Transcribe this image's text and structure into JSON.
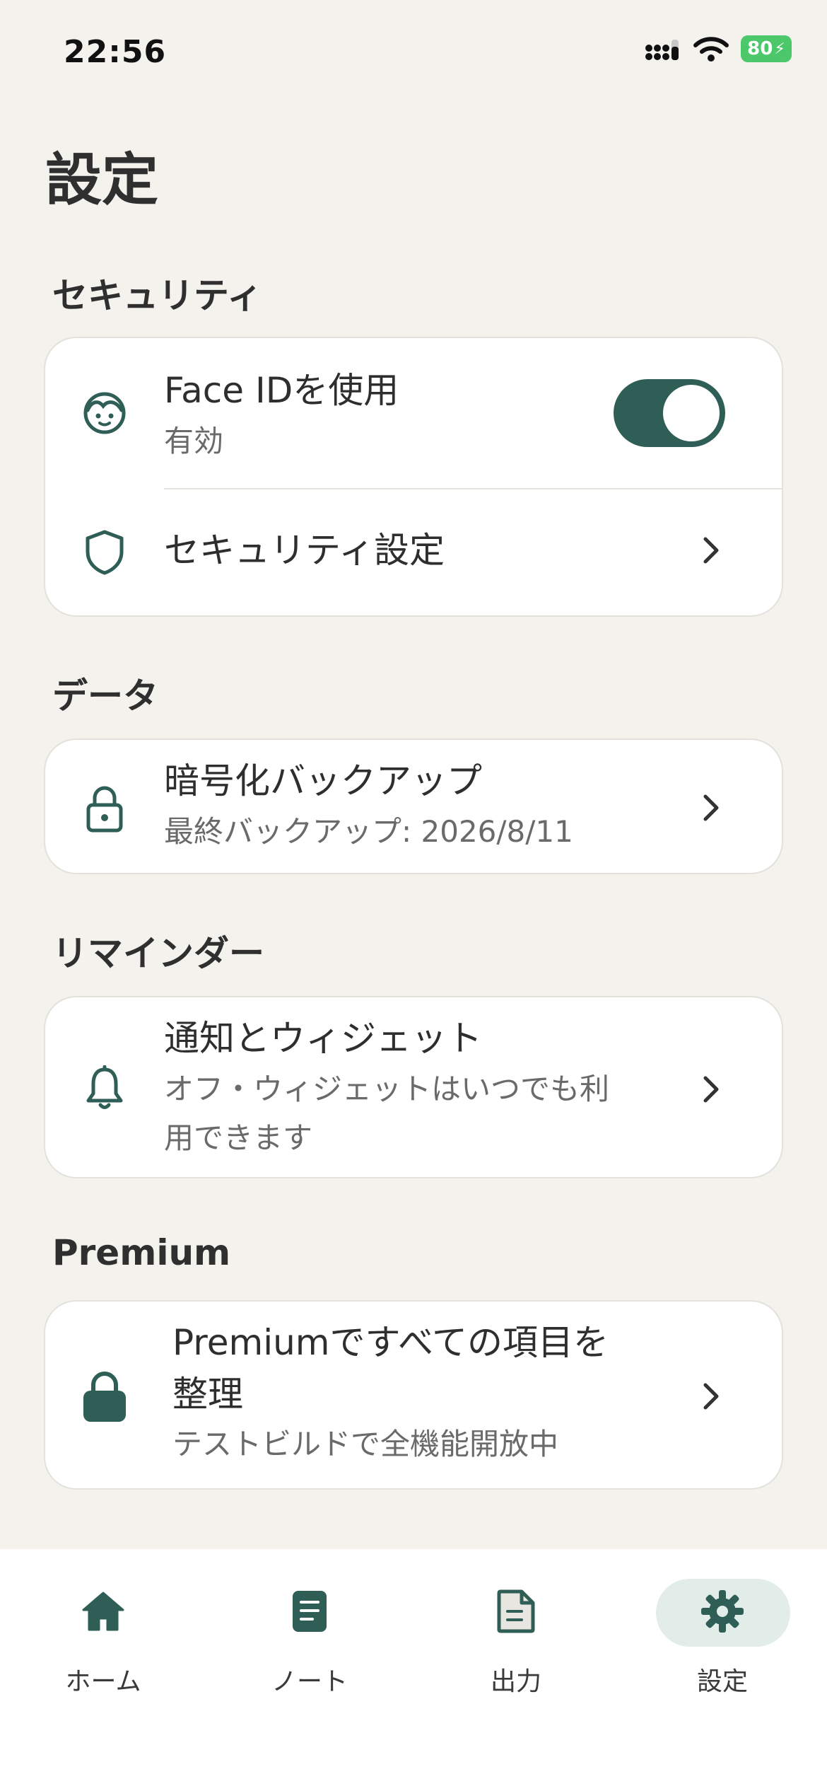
{
  "status_bar": {
    "time": "22:56",
    "battery": "80"
  },
  "page": {
    "title": "設定"
  },
  "sections": {
    "security": {
      "title": "セキュリティ",
      "face_id": {
        "title": "Face IDを使用",
        "subtitle": "有効",
        "toggle_on": true
      },
      "security_settings": {
        "title": "セキュリティ設定"
      }
    },
    "data": {
      "title": "データ",
      "backup": {
        "title": "暗号化バックアップ",
        "subtitle": "最終バックアップ: 2026/8/11"
      }
    },
    "reminder": {
      "title": "リマインダー",
      "notify": {
        "title": "通知とウィジェット",
        "subtitle_line1": "オフ・ウィジェットはいつでも利",
        "subtitle_line2": "用できます"
      }
    },
    "premium": {
      "title": "Premium",
      "item": {
        "title_line1": "Premiumですべての項目を",
        "title_line2": "整理",
        "subtitle": "テストビルドで全機能開放中"
      }
    }
  },
  "tabs": [
    {
      "label": "ホーム",
      "icon": "home-icon"
    },
    {
      "label": "ノート",
      "icon": "note-icon"
    },
    {
      "label": "出力",
      "icon": "document-icon"
    },
    {
      "label": "設定",
      "icon": "gear-icon",
      "active": true
    }
  ],
  "colors": {
    "accent": "#2e5e56",
    "background": "#f4f2ed",
    "active_tab_bg": "#e2ece8"
  }
}
